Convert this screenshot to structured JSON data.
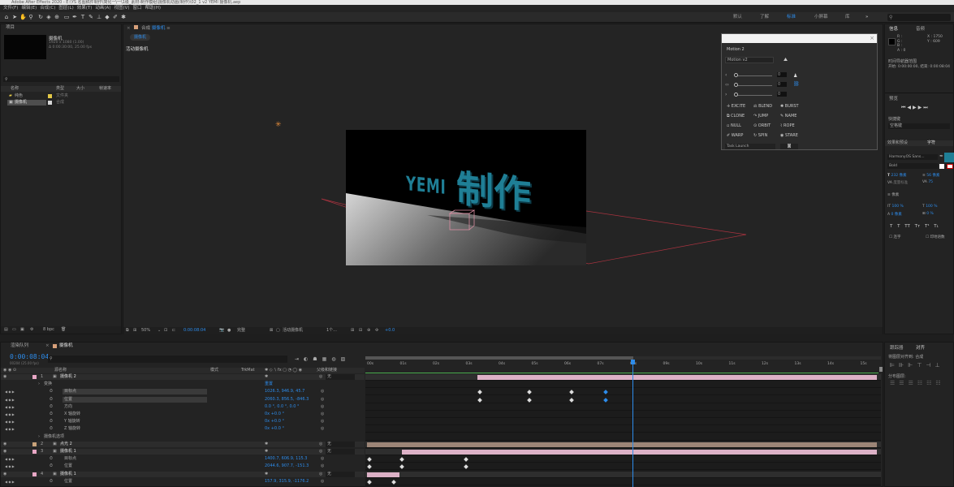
{
  "app": {
    "title": "Adobe After Effects 2020 - E:\\YS 名图稿件制作\\简化一\\一\\1级_素材-制作模组\\摄像机动画(制作)\\02_1 v2 YEMI 摄像机.aep"
  },
  "menu": [
    "文件(F)",
    "编辑(E)",
    "合成(C)",
    "图层(L)",
    "效果(T)",
    "动画(A)",
    "视图(V)",
    "窗口",
    "帮助(H)"
  ],
  "workspaces": [
    "默认",
    "了解",
    "标准",
    "小屏幕",
    "库"
  ],
  "active_workspace": "标准",
  "project": {
    "panel_label": "项目",
    "item_name": "摄像机",
    "item_info1": "1920 x 1080 (1.00)",
    "item_info2": "Δ 0:00:30:00, 25.00 fps",
    "search_icon": "search-icon",
    "col_name": "名称",
    "col_type": "类型",
    "col_size": "大小",
    "col_rate": "帧速率",
    "items": [
      {
        "name": "纯色",
        "type": "文件夹",
        "color": "#e3c847"
      },
      {
        "name": "摄像机",
        "type": "合成",
        "color": "#d7d7d7"
      }
    ],
    "bpc": "8 bpc"
  },
  "comp": {
    "tab_label": "合成",
    "tab_name": "摄像机",
    "sub_tab": "摄像机",
    "view_label": "活动摄像机",
    "zoom": "50%",
    "timecode": "0:00:08:04",
    "quality": "完整",
    "camera": "活动摄像机",
    "views": "1个...",
    "offset": "+0.0"
  },
  "scene": {
    "text1": "YEMI",
    "text2": "制作"
  },
  "motion": {
    "title": "Motion 2",
    "preset": "Motion v2",
    "values": [
      "0",
      "0",
      "0"
    ],
    "buttons": [
      [
        "EXCITE",
        "BLEND",
        "BURST"
      ],
      [
        "CLONE",
        "JUMP",
        "NAME"
      ],
      [
        "NULL",
        "ORBIT",
        "ROPE"
      ],
      [
        "WARP",
        "SPIN",
        "STARE"
      ]
    ],
    "footer": "Task Launch"
  },
  "info": {
    "tab1": "信息",
    "tab2": "音频",
    "r": "R :",
    "g": "G :",
    "b": "B :",
    "a": "A : 0",
    "x": "X : 1750",
    "y": "Y : 609",
    "line1": "时间导航器范围",
    "line2": "开始: 0:00:00:00, 结束: 0:00:08:04"
  },
  "preview": {
    "label": "预览",
    "shortcut_label": "快捷键",
    "shortcut_value": "空格键"
  },
  "effects": {
    "label": "效果和预设",
    "char_label": "字符",
    "font": "HarmonyOS Sans...",
    "weight": "Bold",
    "size": "232 像素",
    "leading": "56 像素",
    "tracking": "度量标准",
    "tracking_val": "75",
    "px_label": "像素",
    "vscale": "100 %",
    "hscale": "100 %",
    "baseline": "0 像素",
    "tsume": "0 %",
    "opt1": "连字",
    "opt2": "印地语数",
    "t_buttons": [
      "T",
      "T",
      "TT",
      "Tт",
      "T¹",
      "T₁"
    ]
  },
  "timeline": {
    "tab_render": "渲染队列",
    "tab_comp": "摄像机",
    "timecode": "0:00:08:04",
    "fps_info": "00204 (25.00 fps)",
    "col_source": "源名称",
    "col_mode": "模式",
    "col_trkmat": "TrkMat",
    "col_parent": "父级和链接",
    "ruler": [
      "00s",
      "01s",
      "02s",
      "03s",
      "04s",
      "05s",
      "06s",
      "07s",
      "08s",
      "09s",
      "10s",
      "11s",
      "12s",
      "13s",
      "14s",
      "15s"
    ]
  },
  "layers": [
    {
      "num": "1",
      "name": "摄像机 2",
      "type": "layer",
      "parent": "无",
      "color": "#e8a7c5"
    },
    {
      "name": "变换",
      "type": "group",
      "reset": "重置"
    },
    {
      "name": "目标点",
      "type": "prop",
      "value": "1026.3, 946.9, 45.7"
    },
    {
      "name": "位置",
      "type": "prop",
      "value": "2060.3, 856.5, -846.3"
    },
    {
      "name": "方向",
      "type": "prop",
      "value": "0.0 °, 0.0 °, 0.0 °"
    },
    {
      "name": "X 轴旋转",
      "type": "prop",
      "value": "0x +0.0 °"
    },
    {
      "name": "Y 轴旋转",
      "type": "prop",
      "value": "0x +0.0 °"
    },
    {
      "name": "Z 轴旋转",
      "type": "prop",
      "value": "0x +0.0 °"
    },
    {
      "name": "摄像机选项",
      "type": "group"
    },
    {
      "num": "2",
      "name": "点光 2",
      "type": "layer",
      "parent": "无",
      "color": "#c9a37a"
    },
    {
      "num": "3",
      "name": "摄像机 1",
      "type": "layer",
      "parent": "无",
      "color": "#e8a7c5"
    },
    {
      "name": "目标点",
      "type": "prop",
      "value": "1400.7, 606.9, 115.3"
    },
    {
      "name": "位置",
      "type": "prop",
      "value": "2044.6, 907.7, -151.3"
    },
    {
      "num": "4",
      "name": "摄像机 1",
      "type": "layer",
      "parent": "无",
      "color": "#e8a7c5"
    },
    {
      "name": "位置",
      "type": "prop",
      "value": "157.9, 315.9, -1176.2"
    }
  ],
  "align": {
    "label": "对齐",
    "tracker_label": "跟踪器",
    "align_to_label": "将图层对齐到:",
    "align_to": "合成",
    "distribute_label": "分布图层:"
  },
  "colors": {
    "accent": "#2d8ceb",
    "teal": "#1f7f96",
    "pink_track": "#dcb1c6",
    "tan_track": "#9c8577"
  }
}
